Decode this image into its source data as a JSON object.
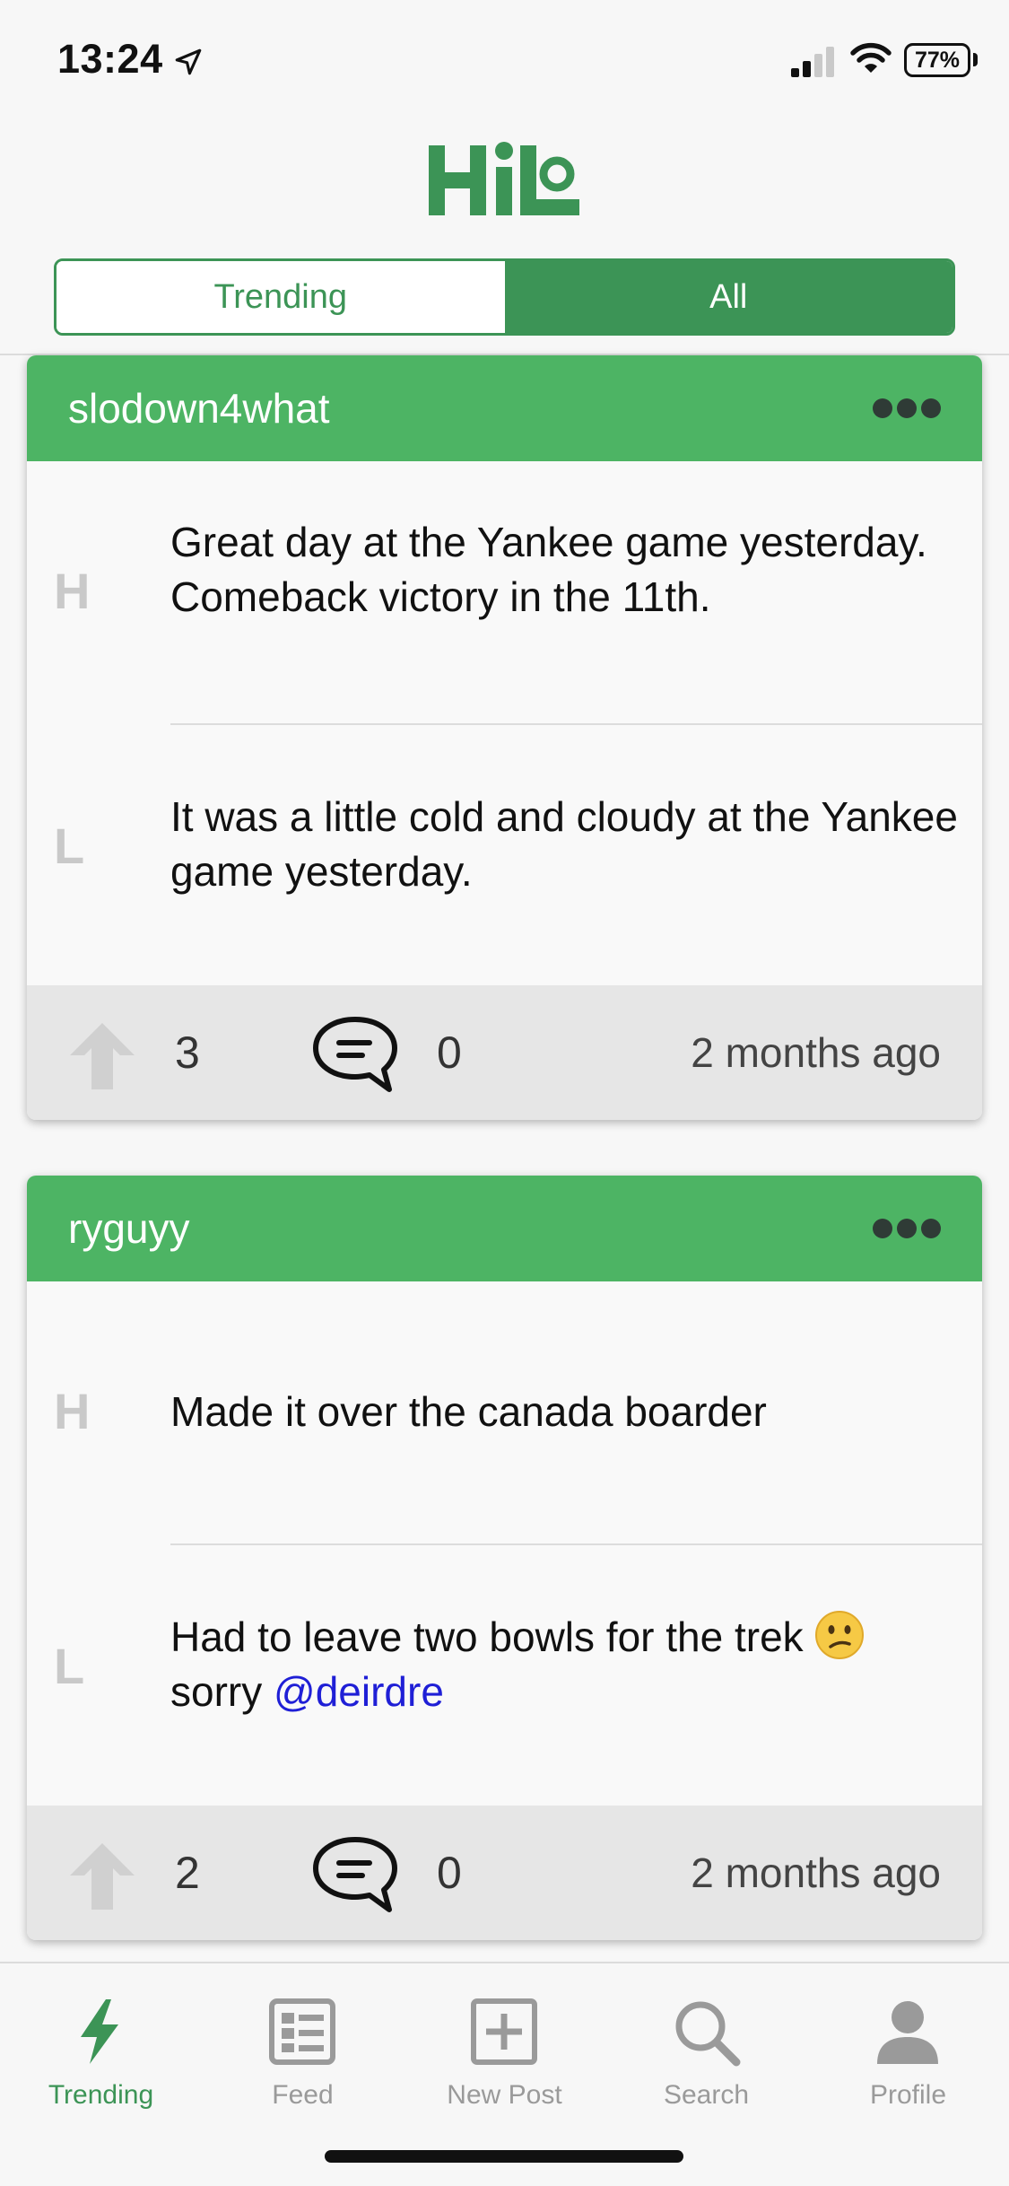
{
  "status_bar": {
    "time": "13:24",
    "battery": "77%"
  },
  "app": {
    "name": "Hilo",
    "brand_color": "#4db464",
    "brand_dark": "#3c9456"
  },
  "segmented": {
    "options": [
      "Trending",
      "All"
    ],
    "selected": "All"
  },
  "posts": [
    {
      "username": "slodown4what",
      "high_letter": "H",
      "high_text": "Great day at the Yankee game yesterday. Comeback victory in the 11th.",
      "low_letter": "L",
      "low_text": "It was a little cold and cloudy at the Yankee game yesterday.",
      "upvotes": "3",
      "comments": "0",
      "time_ago": "2 months ago"
    },
    {
      "username": "ryguyy",
      "high_letter": "H",
      "high_text": "Made it over the canada boarder",
      "low_letter": "L",
      "low_text_prefix": "Had to leave two bowls for the trek",
      "low_text_emoji": "confused-face-emoji",
      "low_text_suffix": "sorry",
      "low_text_mention": "@deirdre",
      "upvotes": "2",
      "comments": "0",
      "time_ago": "2 months ago"
    }
  ],
  "tab_bar": {
    "items": [
      {
        "label": "Trending",
        "icon": "lightning-icon",
        "active": true
      },
      {
        "label": "Feed",
        "icon": "feed-icon",
        "active": false
      },
      {
        "label": "New Post",
        "icon": "plus-square-icon",
        "active": false
      },
      {
        "label": "Search",
        "icon": "search-icon",
        "active": false
      },
      {
        "label": "Profile",
        "icon": "person-icon",
        "active": false
      }
    ]
  }
}
